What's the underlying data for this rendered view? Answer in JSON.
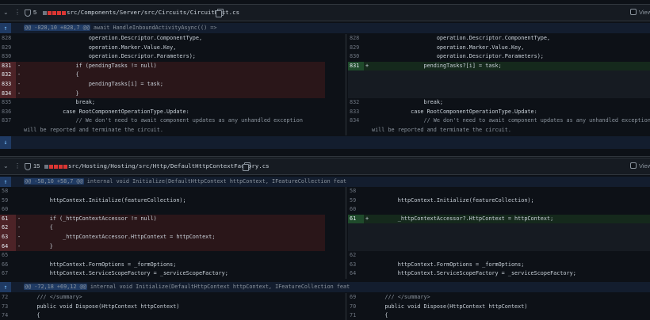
{
  "files": [
    {
      "count": "5",
      "path": "src/Components/Server/src/Circuits/CircuitHost.cs",
      "viewed_label": "Viewed",
      "hunks": [
        {
          "range": "@@ -828,10 +828,7 @@",
          "context": " await HandleInboundActivityAsync(() =>"
        }
      ],
      "rows": [
        {
          "l": {
            "n": "828",
            "t": "ctx",
            "c": "                    operation.Descriptor.ComponentType,"
          },
          "r": {
            "n": "828",
            "t": "ctx",
            "c": "                    operation.Descriptor.ComponentType,"
          }
        },
        {
          "l": {
            "n": "829",
            "t": "ctx",
            "c": "                    operation.Marker.Value.Key,"
          },
          "r": {
            "n": "829",
            "t": "ctx",
            "c": "                    operation.Marker.Value.Key,"
          }
        },
        {
          "l": {
            "n": "830",
            "t": "ctx",
            "c": "                    operation.Descriptor.Parameters);"
          },
          "r": {
            "n": "830",
            "t": "ctx",
            "c": "                    operation.Descriptor.Parameters);"
          }
        },
        {
          "l": {
            "n": "831",
            "t": "del",
            "c": "                if (pendingTasks != null)"
          },
          "r": {
            "n": "831",
            "t": "add",
            "c": "                pendingTasks?[i] = task;"
          }
        },
        {
          "l": {
            "n": "832",
            "t": "del",
            "c": "                {"
          },
          "r": {
            "n": "",
            "t": "emp",
            "c": ""
          }
        },
        {
          "l": {
            "n": "833",
            "t": "del",
            "c": "                    pendingTasks[i] = task;"
          },
          "r": {
            "n": "",
            "t": "emp",
            "c": ""
          }
        },
        {
          "l": {
            "n": "834",
            "t": "del",
            "c": "                }"
          },
          "r": {
            "n": "",
            "t": "emp",
            "c": ""
          }
        },
        {
          "l": {
            "n": "835",
            "t": "ctx",
            "c": "                break;"
          },
          "r": {
            "n": "832",
            "t": "ctx",
            "c": "                break;"
          }
        },
        {
          "l": {
            "n": "836",
            "t": "ctx",
            "c": "            case RootComponentOperationType.Update:"
          },
          "r": {
            "n": "833",
            "t": "ctx",
            "c": "            case RootComponentOperationType.Update:"
          }
        },
        {
          "l": {
            "n": "837",
            "t": "ctx",
            "c": "                // We don't need to await component updates as any unhandled exception"
          },
          "r": {
            "n": "834",
            "t": "ctx",
            "c": "                // We don't need to await component updates as any unhandled exception"
          }
        },
        {
          "l": {
            "n": "",
            "t": "ctx",
            "c": "will be reported and terminate the circuit."
          },
          "r": {
            "n": "",
            "t": "ctx",
            "c": "will be reported and terminate the circuit."
          }
        }
      ]
    },
    {
      "count": "15",
      "path": "src/Hosting/Hosting/src/Http/DefaultHttpContextFactory.cs",
      "viewed_label": "Viewed",
      "hunks": [
        {
          "range": "@@ -58,10 +58,7 @@",
          "context": " internal void Initialize(DefaultHttpContext httpContext, IFeatureCollection feat"
        },
        {
          "range": "@@ -72,18 +69,12 @@",
          "context": " internal void Initialize(DefaultHttpContext httpContext, IFeatureCollection feat"
        }
      ],
      "rows": [
        {
          "l": {
            "n": "58",
            "t": "ctx",
            "c": ""
          },
          "r": {
            "n": "58",
            "t": "ctx",
            "c": ""
          }
        },
        {
          "l": {
            "n": "59",
            "t": "ctx",
            "c": "        httpContext.Initialize(featureCollection);"
          },
          "r": {
            "n": "59",
            "t": "ctx",
            "c": "        httpContext.Initialize(featureCollection);"
          }
        },
        {
          "l": {
            "n": "60",
            "t": "ctx",
            "c": ""
          },
          "r": {
            "n": "60",
            "t": "ctx",
            "c": ""
          }
        },
        {
          "l": {
            "n": "61",
            "t": "del",
            "c": "        if (_httpContextAccessor != null)"
          },
          "r": {
            "n": "61",
            "t": "add",
            "c": "        _httpContextAccessor?.HttpContext = httpContext;"
          }
        },
        {
          "l": {
            "n": "62",
            "t": "del",
            "c": "        {"
          },
          "r": {
            "n": "",
            "t": "emp",
            "c": ""
          }
        },
        {
          "l": {
            "n": "63",
            "t": "del",
            "c": "            _httpContextAccessor.HttpContext = httpContext;"
          },
          "r": {
            "n": "",
            "t": "emp",
            "c": ""
          }
        },
        {
          "l": {
            "n": "64",
            "t": "del",
            "c": "        }"
          },
          "r": {
            "n": "",
            "t": "emp",
            "c": ""
          }
        },
        {
          "l": {
            "n": "65",
            "t": "ctx",
            "c": ""
          },
          "r": {
            "n": "62",
            "t": "ctx",
            "c": ""
          }
        },
        {
          "l": {
            "n": "66",
            "t": "ctx",
            "c": "        httpContext.FormOptions = _formOptions;"
          },
          "r": {
            "n": "63",
            "t": "ctx",
            "c": "        httpContext.FormOptions = _formOptions;"
          }
        },
        {
          "l": {
            "n": "67",
            "t": "ctx",
            "c": "        httpContext.ServiceScopeFactory = _serviceScopeFactory;"
          },
          "r": {
            "n": "64",
            "t": "ctx",
            "c": "        httpContext.ServiceScopeFactory = _serviceScopeFactory;"
          }
        }
      ],
      "rows2": [
        {
          "l": {
            "n": "72",
            "t": "ctx",
            "c": "    /// </summary>"
          },
          "r": {
            "n": "69",
            "t": "ctx",
            "c": "    /// </summary>"
          }
        },
        {
          "l": {
            "n": "73",
            "t": "ctx",
            "c": "    public void Dispose(HttpContext httpContext)"
          },
          "r": {
            "n": "70",
            "t": "ctx",
            "c": "    public void Dispose(HttpContext httpContext)"
          }
        },
        {
          "l": {
            "n": "74",
            "t": "ctx",
            "c": "    {"
          },
          "r": {
            "n": "71",
            "t": "ctx",
            "c": "    {"
          }
        }
      ]
    }
  ],
  "markers": {
    "del": "-",
    "add": "+"
  },
  "icons": {
    "chevron": "chevron-down-icon",
    "kebab": "kebab-icon",
    "shield": "shield-icon",
    "copy": "copy-icon",
    "expand": "expand-up-icon"
  },
  "colors": {
    "deleted": "#4d2327",
    "added": "#1f4a2b",
    "hunk": "#131d2e",
    "accent": "#79c0ff"
  }
}
